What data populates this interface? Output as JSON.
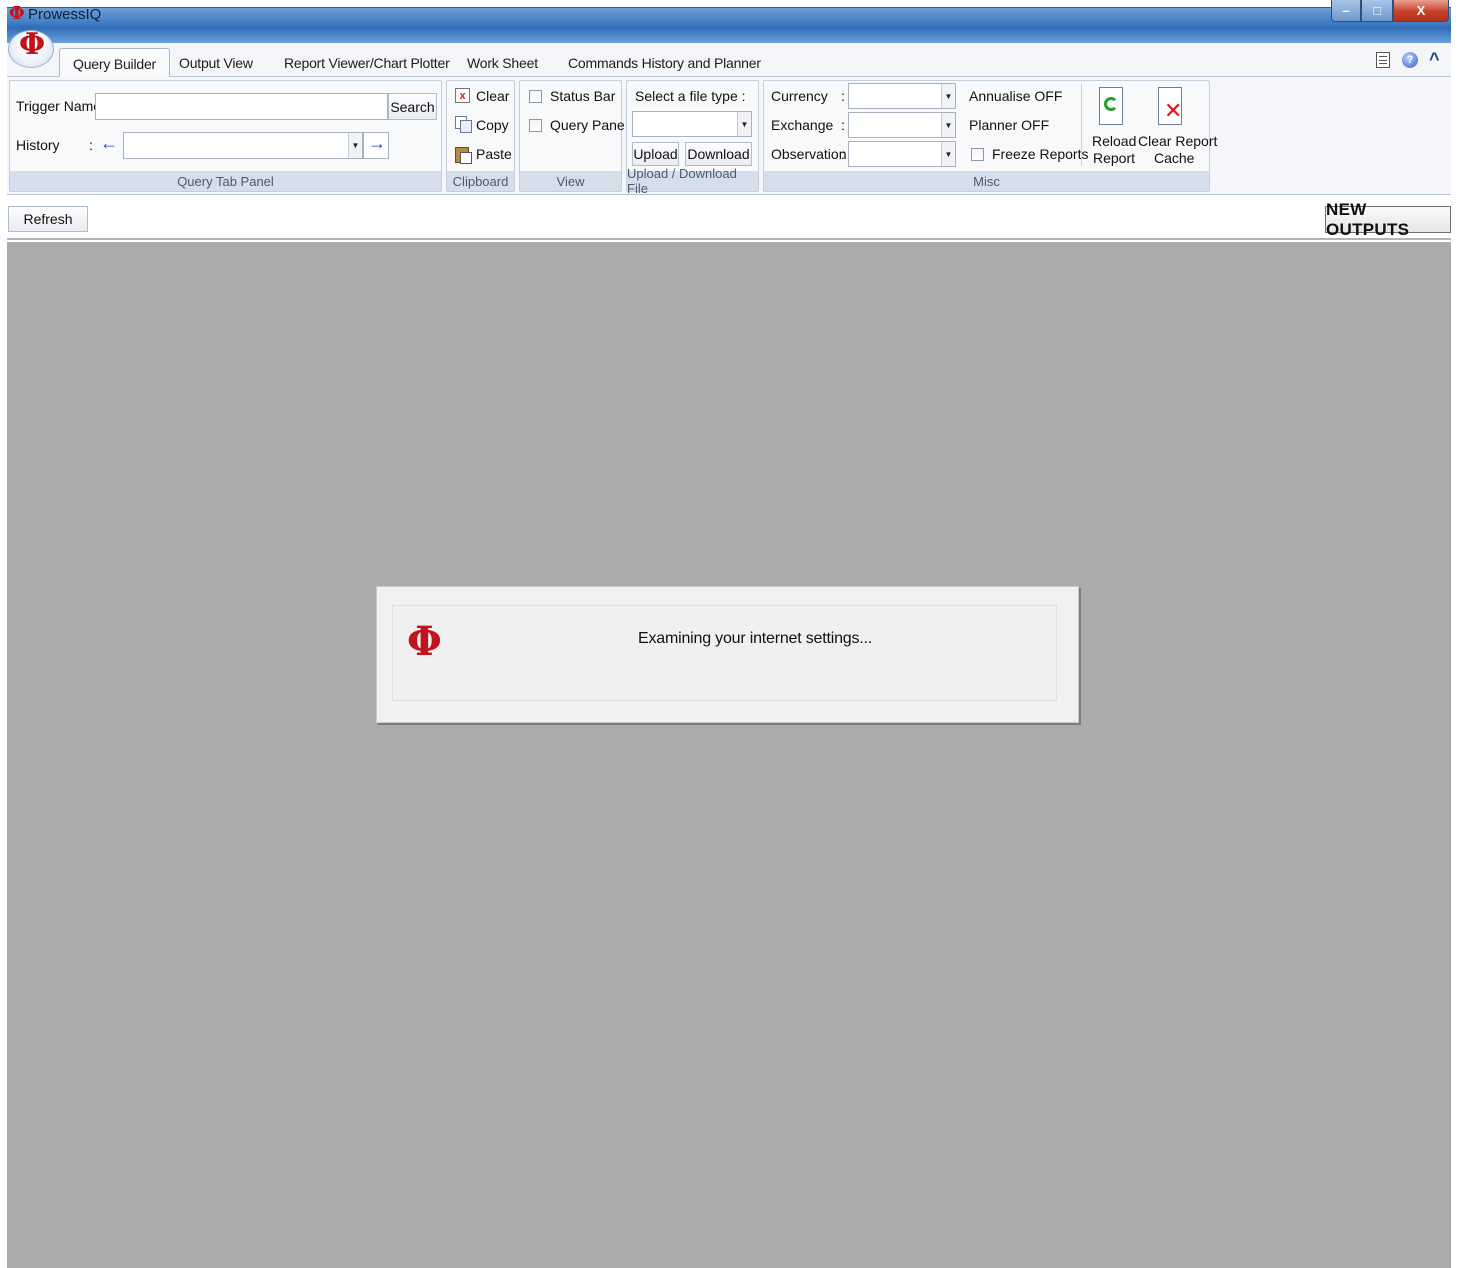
{
  "window": {
    "title": "ProwessIQ",
    "logo_glyph": "Φ",
    "controls": {
      "minimize": "–",
      "maximize": "□",
      "close": "X"
    }
  },
  "tabs": [
    {
      "label": "Query Builder",
      "active": true
    },
    {
      "label": "Output View",
      "active": false
    },
    {
      "label": "Report Viewer/Chart Plotter",
      "active": false
    },
    {
      "label": "Work Sheet",
      "active": false
    },
    {
      "label": "Commands History and Planner",
      "active": false
    }
  ],
  "right_icons": {
    "doc": "document-icon",
    "help": "help-icon",
    "collapse": "^"
  },
  "ribbon": {
    "query_tab_panel": {
      "label": "Query Tab Panel",
      "trigger_label": "Trigger Name:",
      "trigger_value": "",
      "search_label": "Search",
      "history_label": "History",
      "history_colon": ":",
      "history_value": "",
      "prev_arrow": "←",
      "next_arrow": "→"
    },
    "clipboard": {
      "label": "Clipboard",
      "clear": "Clear",
      "copy": "Copy",
      "paste": "Paste"
    },
    "view": {
      "label": "View",
      "status_bar": "Status Bar",
      "query_pane": "Query Pane"
    },
    "upload_download": {
      "label": "Upload / Download File",
      "select_label": "Select a file type :",
      "file_type_value": "",
      "upload": "Upload",
      "download": "Download"
    },
    "misc": {
      "label": "Misc",
      "currency": "Currency",
      "exchange": "Exchange",
      "observation": "Observation",
      "colon": ":",
      "annualise": "Annualise OFF",
      "planner": "Planner OFF",
      "freeze_reports": "Freeze Reports",
      "reload_line1": "Reload",
      "reload_line2": "Report",
      "clear_line1": "Clear Report",
      "clear_line2": "Cache"
    }
  },
  "toolbar": {
    "refresh": "Refresh",
    "new_outputs": "NEW OUTPUTS"
  },
  "dialog": {
    "message": "Examining your internet settings..."
  }
}
